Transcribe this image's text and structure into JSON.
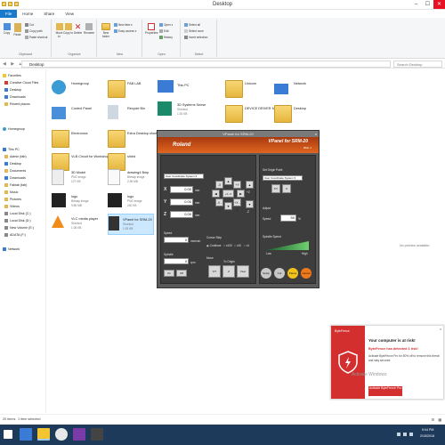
{
  "window": {
    "title": "Desktop"
  },
  "tabs": [
    "File",
    "Home",
    "Share",
    "View"
  ],
  "ribbon": {
    "clipboard": {
      "label": "Clipboard",
      "pin": "Pin to Quick access",
      "copy": "Copy",
      "paste": "Paste",
      "cut": "Cut",
      "copy_path": "Copy path",
      "paste_shortcut": "Paste shortcut"
    },
    "organize": {
      "label": "Organize",
      "move_to": "Move to",
      "copy_to": "Copy to",
      "delete": "Delete",
      "rename": "Rename"
    },
    "new": {
      "label": "New",
      "new_folder": "New folder",
      "new_item": "New item ▾",
      "easy_access": "Easy access ▾"
    },
    "open": {
      "label": "Open",
      "properties": "Properties",
      "open": "Open ▾",
      "edit": "Edit",
      "history": "History"
    },
    "select": {
      "label": "Select",
      "select_all": "Select all",
      "select_none": "Select none",
      "invert": "Invert selection"
    }
  },
  "address": {
    "path": "Desktop",
    "search_placeholder": "Search Desktop"
  },
  "nav": {
    "quick_access": "Favorites",
    "pinned": [
      "Creative Cloud Files",
      "Desktop",
      "Downloads",
      "Recent places"
    ],
    "homegroup": "Homegroup",
    "thispc": "This PC",
    "thispc_items": [
      "Admin (fab)",
      "Desktop",
      "Documents",
      "Downloads",
      "Fablab (fab)",
      "Music",
      "Pictures",
      "Videos",
      "Local Disk (C:)",
      "Local Disk (D:)",
      "New Volume (E:)",
      "ADATA (F:)"
    ],
    "network": "Network"
  },
  "files": [
    {
      "name": "Homegroup",
      "sub": ""
    },
    {
      "name": "FAB LAB",
      "sub": ""
    },
    {
      "name": "This PC",
      "sub": ""
    },
    {
      "name": "Unicorn",
      "sub": ""
    },
    {
      "name": "Network",
      "sub": ""
    },
    {
      "name": "Control Panel",
      "sub": ""
    },
    {
      "name": "Recycle Bin",
      "sub": ""
    },
    {
      "name": "3D Systems Sense",
      "sub": "Shortcut\n1.30 KB"
    },
    {
      "name": "DEVICE DRIVER MX15",
      "sub": ""
    },
    {
      "name": "Desktop",
      "sub": ""
    },
    {
      "name": "Electronics",
      "sub": ""
    },
    {
      "name": "Extra Desktop shortcuts",
      "sub": ""
    },
    {
      "name": "VLB Circuit for Workshop",
      "sub": ""
    },
    {
      "name": "shled",
      "sub": ""
    },
    {
      "name": "3D Model",
      "sub": "PNG image\n127 KB"
    },
    {
      "name": "drawing4 Bmp",
      "sub": "Bitmap image\n2.95 MB"
    },
    {
      "name": "logo",
      "sub": "Bitmap image\n9.85 MB"
    },
    {
      "name": "logo",
      "sub": "PNG image\n240 KB"
    },
    {
      "name": "VLC media player",
      "sub": "Shortcut\n1.08 KB"
    },
    {
      "name": "VPanel for SRM-20",
      "sub": "Shortcut\n1.93 KB"
    }
  ],
  "no_preview": "No preview available.",
  "vpanel": {
    "title": "VPanel for SRM-20",
    "close": "x",
    "logo": "Roland",
    "brand": "VPanel for SRM-20",
    "model": "RML-1",
    "coord_system": "User Coordinate System",
    "axes": [
      {
        "label": "X",
        "value": "0.00",
        "unit": "mm"
      },
      {
        "label": "Y",
        "value": "0.00",
        "unit": "mm"
      },
      {
        "label": "Z",
        "value": "0.00",
        "unit": "mm"
      }
    ],
    "jog": {
      "y_plus": "+Y",
      "y_minus": "-Y",
      "x_plus": "+X",
      "x_minus": "-X",
      "z_plus": "+Z",
      "z_minus": "-Z",
      "xy_pp": "+Y +X",
      "xy_mp": "-X +Y",
      "xy_pm": "+X -Y",
      "xy_mm": "-X -Y"
    },
    "speed_label": "Speed",
    "speed_value": "0",
    "speed_unit": "mm/min",
    "spindle_label": "Spindle",
    "spindle_value": "0",
    "spindle_unit": "rpm",
    "spindle_on": "On",
    "spindle_off": "Off",
    "cursor_step": "Cursor Step",
    "steps": [
      "Continue",
      "x100",
      "x10",
      "x1"
    ],
    "move": "Move",
    "to_origin": "To Origin",
    "move_btns": [
      "X/Y",
      "Z",
      "View"
    ],
    "set_origin": "Set Origin Point",
    "origin_sel": "User Coordinate System",
    "origin_btns": [
      "X/Y",
      "Z"
    ],
    "adjust": "Adjust",
    "adjust_speed": "Speed",
    "adjust_value": "50",
    "adjust_unit": "%",
    "spindle_speed": "Spindle Speed",
    "low": "Low",
    "high": "High",
    "bottom_btns": [
      "Setup",
      "Cut",
      "Pause",
      "Cancel"
    ]
  },
  "ad": {
    "brand": "ByteFence",
    "close": "x",
    "headline": "Your computer is at risk!",
    "detected": "ByteFence has detected 1 risk!",
    "body": "Activate ByteFence Pro for 80% off to remove this threat and stay secured.",
    "button": "Activate ByteFence Pro",
    "colors": {
      "accent": "#d32f2f"
    }
  },
  "activate_windows": "Activate Windows",
  "status": {
    "count": "20 items",
    "selected": "1 item selected"
  },
  "taskbar": {
    "time": "9:04 PM",
    "date": "2/15/2018"
  }
}
